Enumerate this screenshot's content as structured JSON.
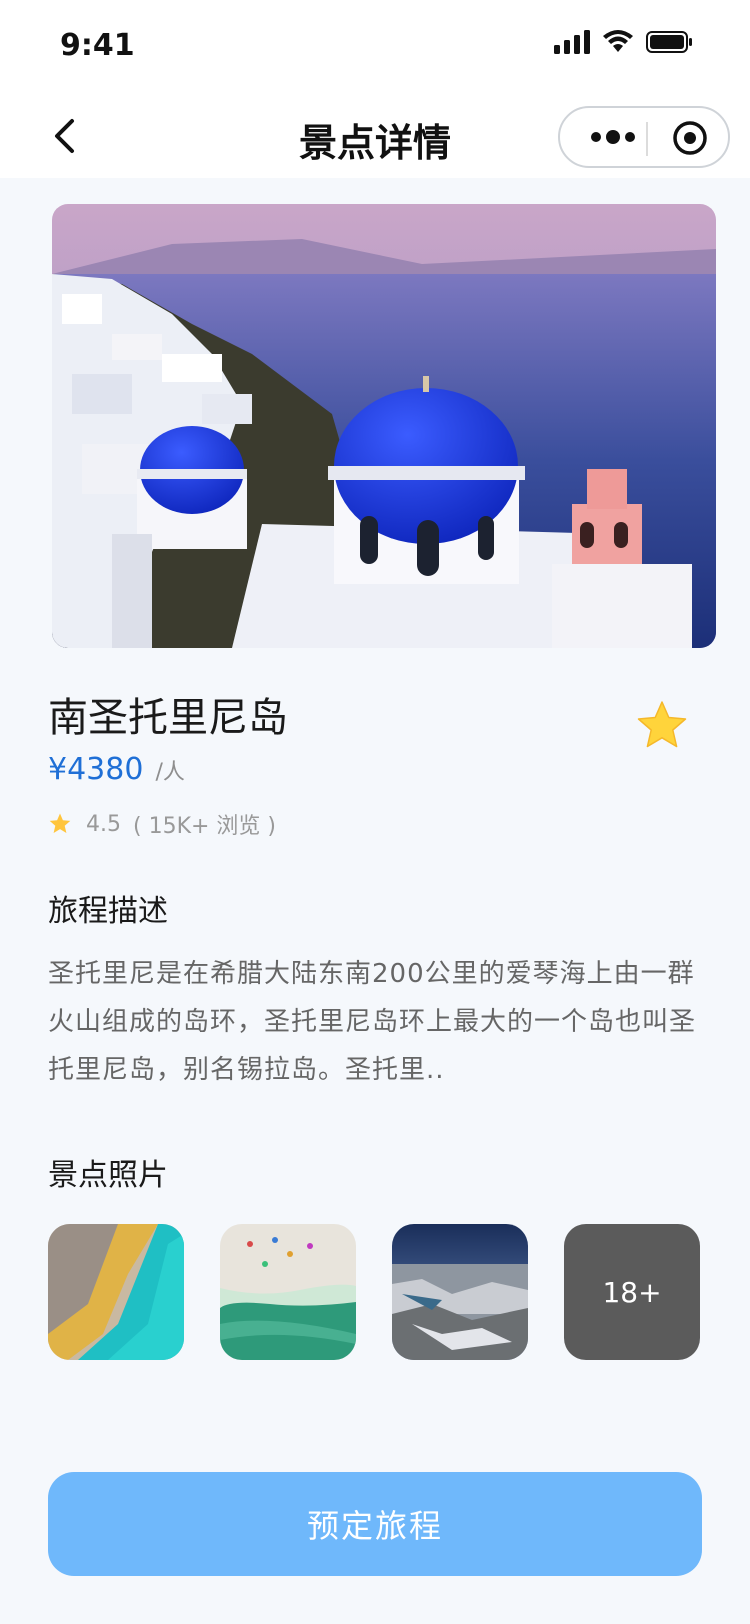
{
  "status_bar": {
    "time": "9:41"
  },
  "navbar": {
    "title": "景点详情"
  },
  "spot": {
    "name": "南圣托里尼岛",
    "price": "¥4380",
    "price_unit": "/人",
    "rating": "4.5",
    "views": "( 15K+ 浏览 )",
    "favorited": true
  },
  "description": {
    "title": "旅程描述",
    "text": "圣托里尼是在希腊大陆东南200公里的爱琴海上由一群火山组成的岛环，圣托里尼岛环上最大的一个岛也叫圣托里尼岛，别名锡拉岛。圣托里.."
  },
  "photos": {
    "title": "景点照片",
    "more_count": "18+"
  },
  "cta": {
    "label": "预定旅程"
  },
  "colors": {
    "accent": "#1f6fd6",
    "button": "#6fb8fb",
    "star": "#ffc53d"
  }
}
